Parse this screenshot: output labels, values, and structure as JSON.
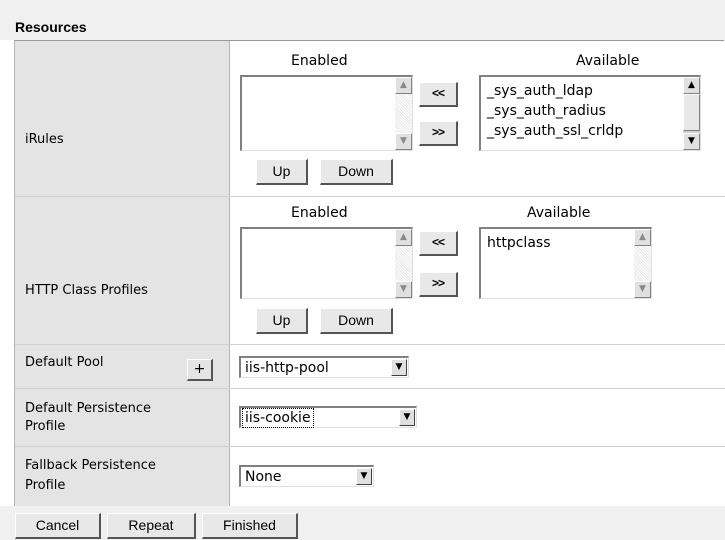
{
  "section_title": "Resources",
  "irules": {
    "label": "iRules",
    "enabled_header": "Enabled",
    "available_header": "Available",
    "enabled_items": [],
    "available_items": [
      "_sys_auth_ldap",
      "_sys_auth_radius",
      "_sys_auth_ssl_crldp"
    ],
    "move_left_label": "<<",
    "move_right_label": ">>",
    "up_label": "Up",
    "down_label": "Down"
  },
  "http_class_profiles": {
    "label": "HTTP Class Profiles",
    "enabled_header": "Enabled",
    "available_header": "Available",
    "enabled_items": [],
    "available_items": [
      "httpclass"
    ],
    "move_left_label": "<<",
    "move_right_label": ">>",
    "up_label": "Up",
    "down_label": "Down"
  },
  "default_pool": {
    "label": "Default Pool",
    "add_label": "+",
    "value": "iis-http-pool"
  },
  "default_persistence": {
    "label_line1": "Default Persistence",
    "label_line2": "Profile",
    "value": "iis-cookie"
  },
  "fallback_persistence": {
    "label_line1": "Fallback Persistence",
    "label_line2": "Profile",
    "value": "None"
  },
  "footer": {
    "cancel_label": "Cancel",
    "repeat_label": "Repeat",
    "finished_label": "Finished"
  },
  "icons": {
    "scroll_up": "▲",
    "scroll_down": "▼",
    "dropdown": "▼"
  }
}
